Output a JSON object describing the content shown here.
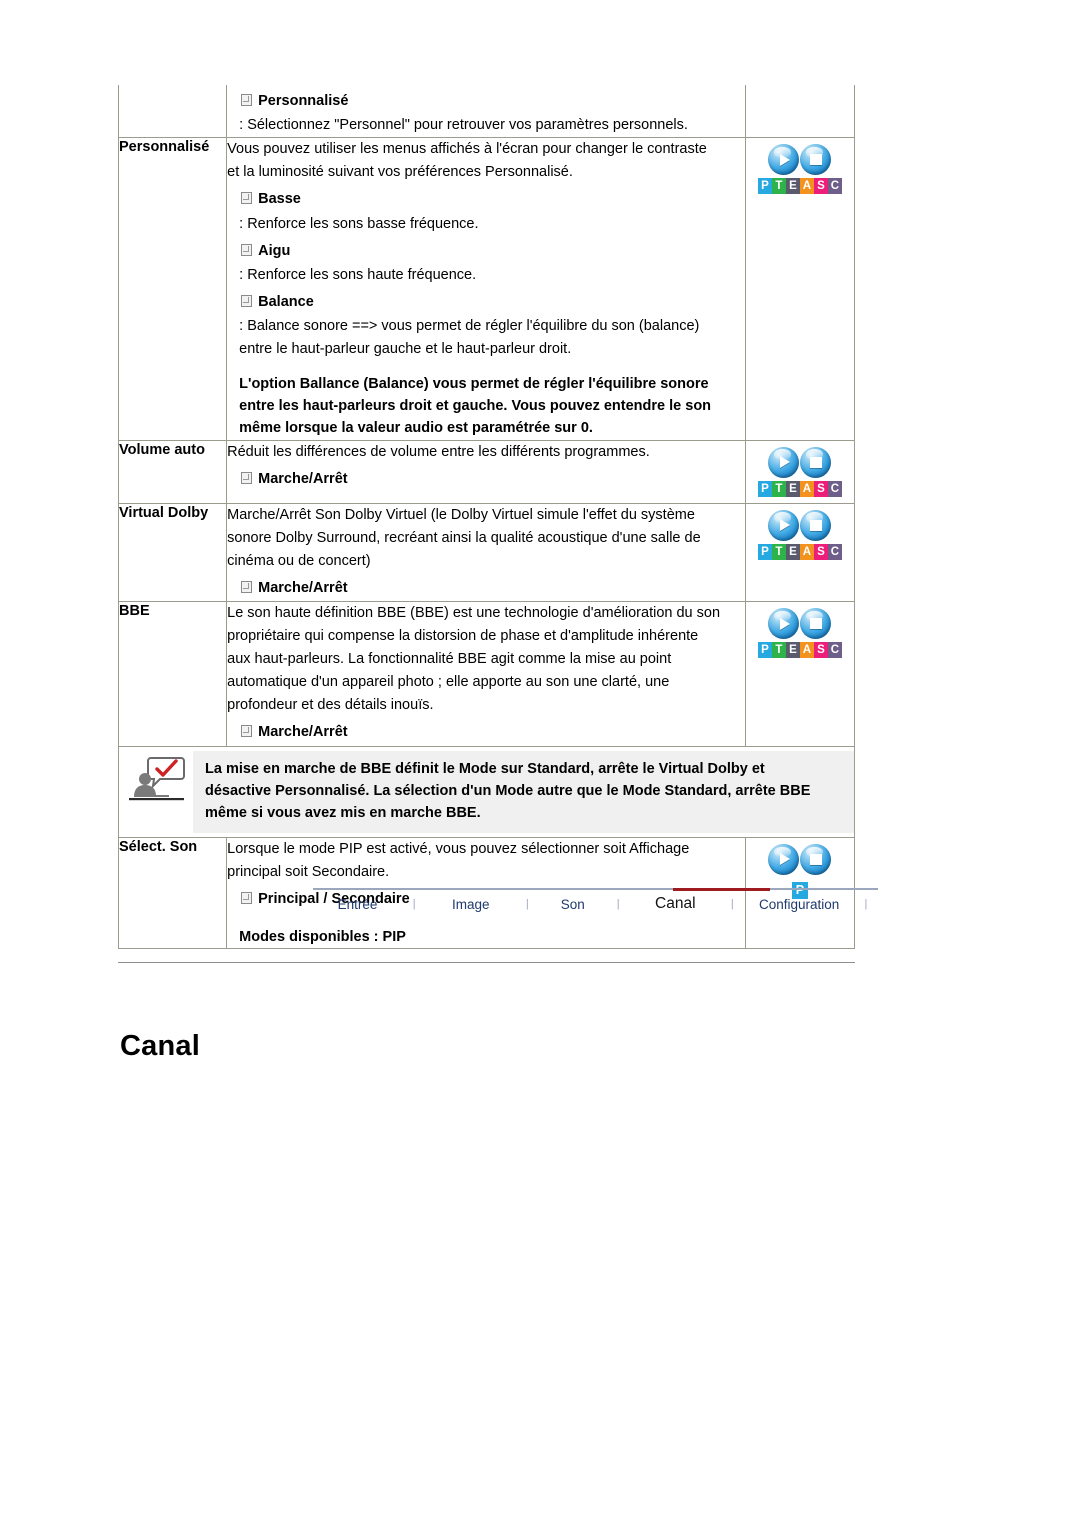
{
  "document": {
    "section_heading": "Canal"
  },
  "table": {
    "rows": [
      {
        "label": "",
        "subitem": "Personnalisé",
        "colon_line": ": Sélectionnez \"Personnel\" pour retrouver vos paramètres personnels.",
        "icon": "none"
      },
      {
        "label": "Personnalisé",
        "para1": "Vous pouvez utiliser les menus affichés à l'écran pour changer le contraste",
        "para2": "et la luminosité suivant vos préférences Personnalisé.",
        "sub_basse": "Basse",
        "basse_desc": ": Renforce les sons basse fréquence.",
        "sub_aigu": "Aigu",
        "aigu_desc": ": Renforce les sons haute fréquence.",
        "sub_balance": "Balance",
        "balance_desc1": ": Balance sonore ==> vous permet de régler l'équilibre du son (balance)",
        "balance_desc2": "entre le haut-parleur gauche et le haut-parleur droit.",
        "bold_note1": "L'option Ballance (Balance) vous permet de régler l'équilibre sonore",
        "bold_note2": "entre les haut-parleurs droit et gauche. Vous pouvez entendre le son",
        "bold_note3": "même lorsque la valeur audio est paramétrée sur 0.",
        "icon": "pteasc"
      },
      {
        "label": "Volume auto",
        "para1": "Réduit les différences de volume entre les différents programmes.",
        "subitem": "Marche/Arrêt",
        "icon": "pteasc"
      },
      {
        "label": "Virtual Dolby",
        "para1": "Marche/Arrêt Son Dolby Virtuel (le Dolby Virtuel simule l'effet du système",
        "para2": "sonore Dolby Surround, recréant ainsi la qualité acoustique d'une salle de",
        "para3": "cinéma ou de concert)",
        "subitem": "Marche/Arrêt",
        "icon": "pteasc"
      },
      {
        "label": "BBE",
        "para1": "Le son haute définition BBE (BBE) est une technologie d'amélioration du son",
        "para2": "propriétaire qui compense la distorsion de phase et d'amplitude inhérente",
        "para3": "aux haut-parleurs. La fonctionnalité BBE agit comme la mise au point",
        "para4": "automatique d'un appareil photo ; elle apporte au son une clarté, une",
        "para5": "profondeur et des détails inouïs.",
        "subitem": "Marche/Arrêt",
        "icon": "pteasc"
      },
      {
        "label": "Sélect. Son",
        "para1": "Lorsque le mode PIP est activé, vous pouvez sélectionner soit Affichage",
        "para2": "principal soit Secondaire.",
        "subitem": "Principal / Secondaire",
        "modes": "Modes disponibles : PIP",
        "icon": "pip"
      }
    ]
  },
  "note": {
    "icon_name": "person-speech-bubble-check-icon",
    "line1": "La mise en marche de BBE définit le Mode sur Standard, arrête le Virtual Dolby et",
    "line2": "désactive Personnalisé. La sélection d'un Mode autre que le Mode Standard, arrête BBE",
    "line3": "même si vous avez mis en marche BBE."
  },
  "icons": {
    "pteasc_letters": [
      "P",
      "T",
      "E",
      "A",
      "S",
      "C"
    ],
    "pteasc_colors": [
      "#26a9e0",
      "#2eb34a",
      "#5a5a6e",
      "#f4921e",
      "#ec1e79",
      "#6d5f8a"
    ],
    "pip_letter": "P",
    "pip_color": "#26a9e0",
    "orb_play_name": "play-orb-icon",
    "orb_stop_name": "stop-orb-icon"
  },
  "nav": {
    "items": [
      {
        "label": "Entrée",
        "active": false
      },
      {
        "label": "Image",
        "active": false
      },
      {
        "label": "Son",
        "active": false
      },
      {
        "label": "Canal",
        "active": true
      },
      {
        "label": "Configuration",
        "active": false
      }
    ],
    "separator": "|",
    "active_color": "#9e1b22",
    "link_color": "#1f3a6e"
  }
}
